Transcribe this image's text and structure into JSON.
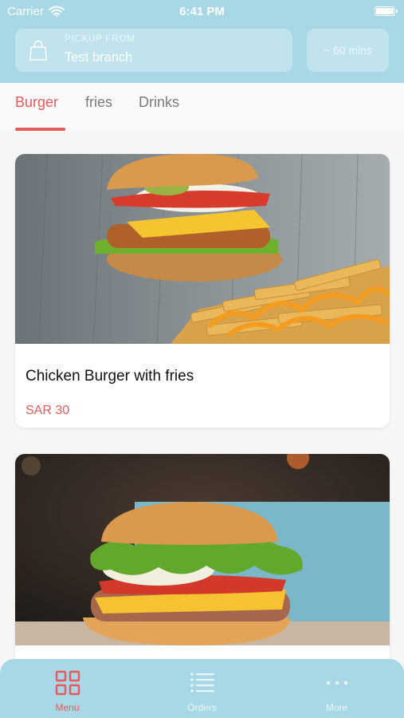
{
  "status_bar": {
    "carrier": "Carrier",
    "time": "6:41 PM"
  },
  "header": {
    "pickup_label": "PICKUP FROM",
    "pickup_value": "Test branch",
    "eta": "~ 60 mins"
  },
  "tabs": [
    {
      "label": "Burger",
      "active": true
    },
    {
      "label": "fries",
      "active": false
    },
    {
      "label": "Drinks",
      "active": false
    }
  ],
  "products": [
    {
      "name": "Chicken Burger with fries",
      "price": "SAR 30"
    },
    {
      "name": "",
      "price": ""
    }
  ],
  "bottom_nav": [
    {
      "label": "Menu",
      "icon": "grid-icon",
      "active": true
    },
    {
      "label": "Orders",
      "icon": "list-icon",
      "active": false
    },
    {
      "label": "More",
      "icon": "more-dots-icon",
      "active": false
    }
  ],
  "colors": {
    "accent": "#e8595b",
    "header": "#a8d8e6"
  }
}
